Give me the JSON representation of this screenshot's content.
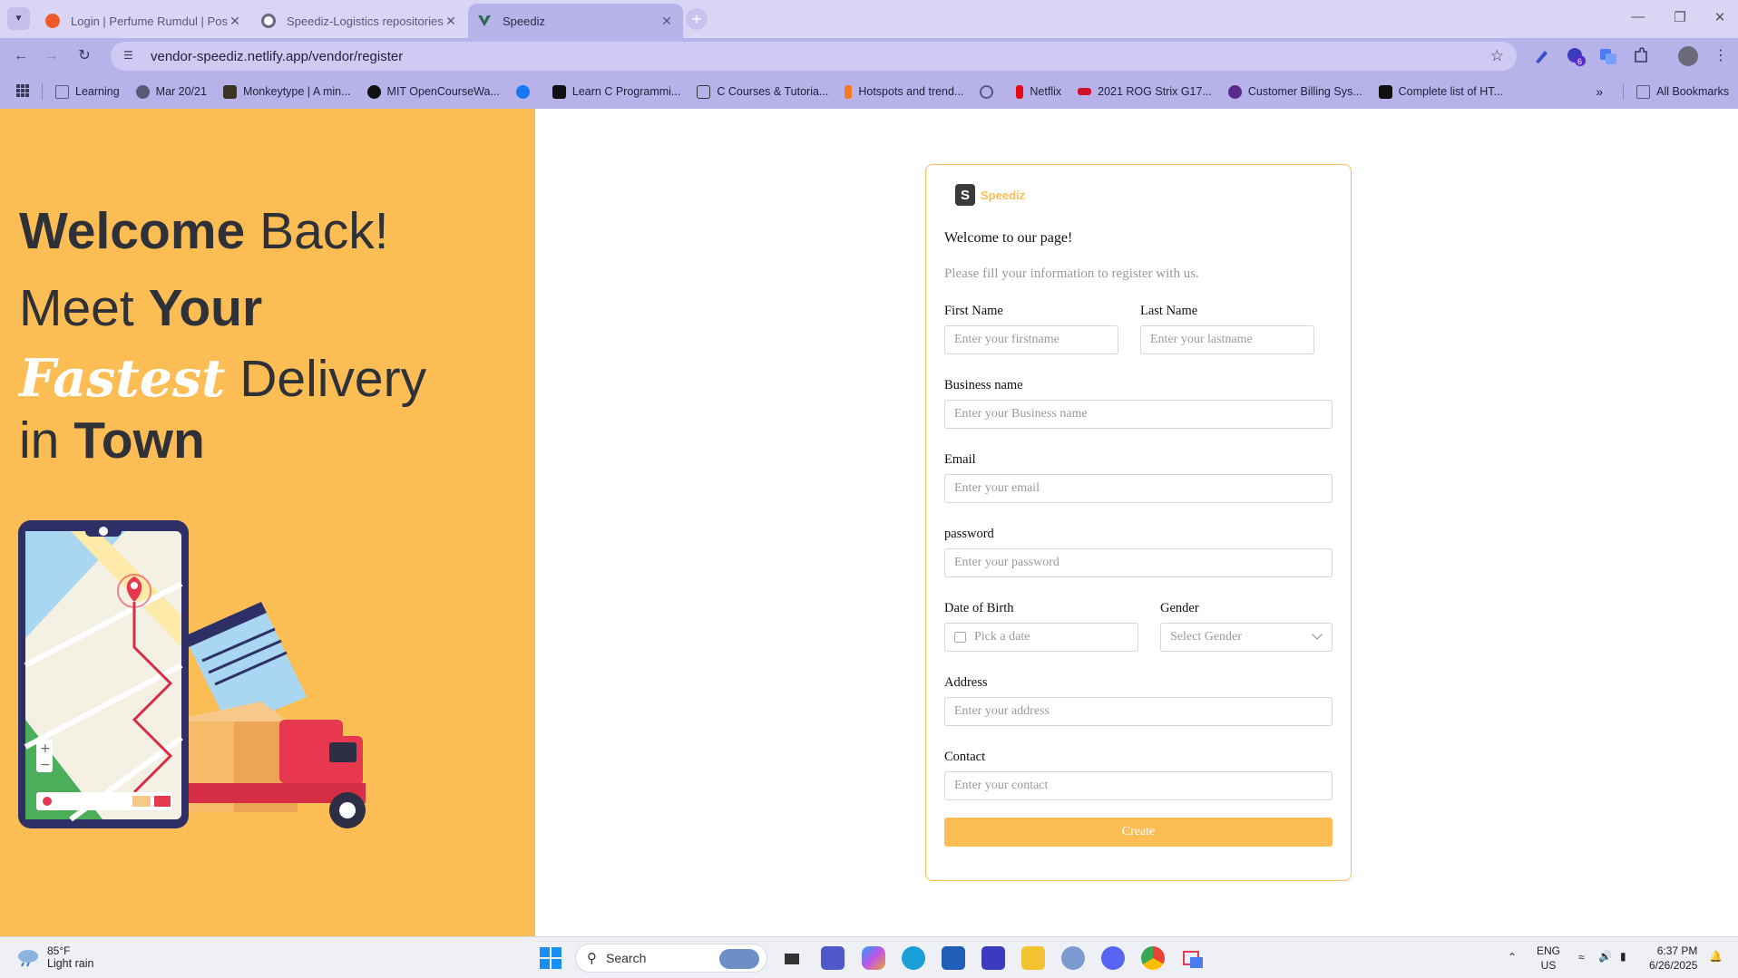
{
  "browser": {
    "tabs": [
      {
        "title": "Login | Perfume Rumdul | Postm",
        "favicon_color": "#f05a2a"
      },
      {
        "title": "Speediz-Logistics repositories",
        "favicon_color": "#6a6880"
      },
      {
        "title": "Speediz",
        "favicon_color": "#2f6a4e"
      }
    ],
    "url": "vendor-speediz.netlify.app/vendor/register",
    "bookmarks": [
      {
        "label": "Learning",
        "icon": "folder-icon",
        "color": "#5a5878"
      },
      {
        "label": "Mar 20/21",
        "icon": "globe-icon",
        "color": "#5a5878"
      },
      {
        "label": "Monkeytype | A min...",
        "icon": "monkeytype-icon",
        "color": "#3b3420"
      },
      {
        "label": "MIT OpenCourseWa...",
        "icon": "mit-icon",
        "color": "#111111"
      },
      {
        "label": "",
        "icon": "facebook-icon",
        "color": "#1877f2"
      },
      {
        "label": "Learn C Programmi...",
        "icon": "learnc-icon",
        "color": "#111111"
      },
      {
        "label": "C Courses & Tutoria...",
        "icon": "c-courses-icon",
        "color": "#333333"
      },
      {
        "label": "Hotspots and trend...",
        "icon": "hotspots-icon",
        "color": "#f47a20"
      },
      {
        "label": "",
        "icon": "globe-icon",
        "color": "#5a5878"
      },
      {
        "label": "Netflix",
        "icon": "netflix-icon",
        "color": "#e50914"
      },
      {
        "label": "2021 ROG Strix G17...",
        "icon": "rog-icon",
        "color": "#d0112b"
      },
      {
        "label": "Customer Billing Sys...",
        "icon": "billing-icon",
        "color": "#5a2a8a"
      },
      {
        "label": "Complete list of HT...",
        "icon": "ff-icon",
        "color": "#111111"
      }
    ],
    "all_bookmarks": "All Bookmarks"
  },
  "hero": {
    "line1_bold": "Welcome",
    "line1_light": "Back!",
    "line2_light": "Meet",
    "line2_bold": "Your",
    "line3_script": "Fastest",
    "line3_light": "Delivery",
    "line4_light": "in",
    "line4_bold": "Town"
  },
  "form": {
    "brand": "Speediz",
    "logo_letter": "S",
    "title": "Welcome to our page!",
    "subtitle": "Please fill your information to register with us.",
    "first_name_label": "First Name",
    "first_name_placeholder": "Enter your firstname",
    "last_name_label": "Last Name",
    "last_name_placeholder": "Enter your lastname",
    "business_label": "Business name",
    "business_placeholder": "Enter your Business name",
    "email_label": "Email",
    "email_placeholder": "Enter your email",
    "password_label": "password",
    "password_placeholder": "Enter your password",
    "dob_label": "Date of Birth",
    "dob_placeholder": "Pick a date",
    "gender_label": "Gender",
    "gender_placeholder": "Select Gender",
    "address_label": "Address",
    "address_placeholder": "Enter your address",
    "contact_label": "Contact",
    "contact_placeholder": "Enter your contact",
    "submit_label": "Create"
  },
  "taskbar": {
    "weather_temp": "85°F",
    "weather_desc": "Light rain",
    "search_label": "Search",
    "lang_top": "ENG",
    "lang_bottom": "US",
    "time": "6:37 PM",
    "date": "6/26/2025"
  },
  "colors": {
    "accent": "#fdbd55",
    "tab_bar": "#d9d5f5",
    "toolbar": "#b8b2ea"
  }
}
